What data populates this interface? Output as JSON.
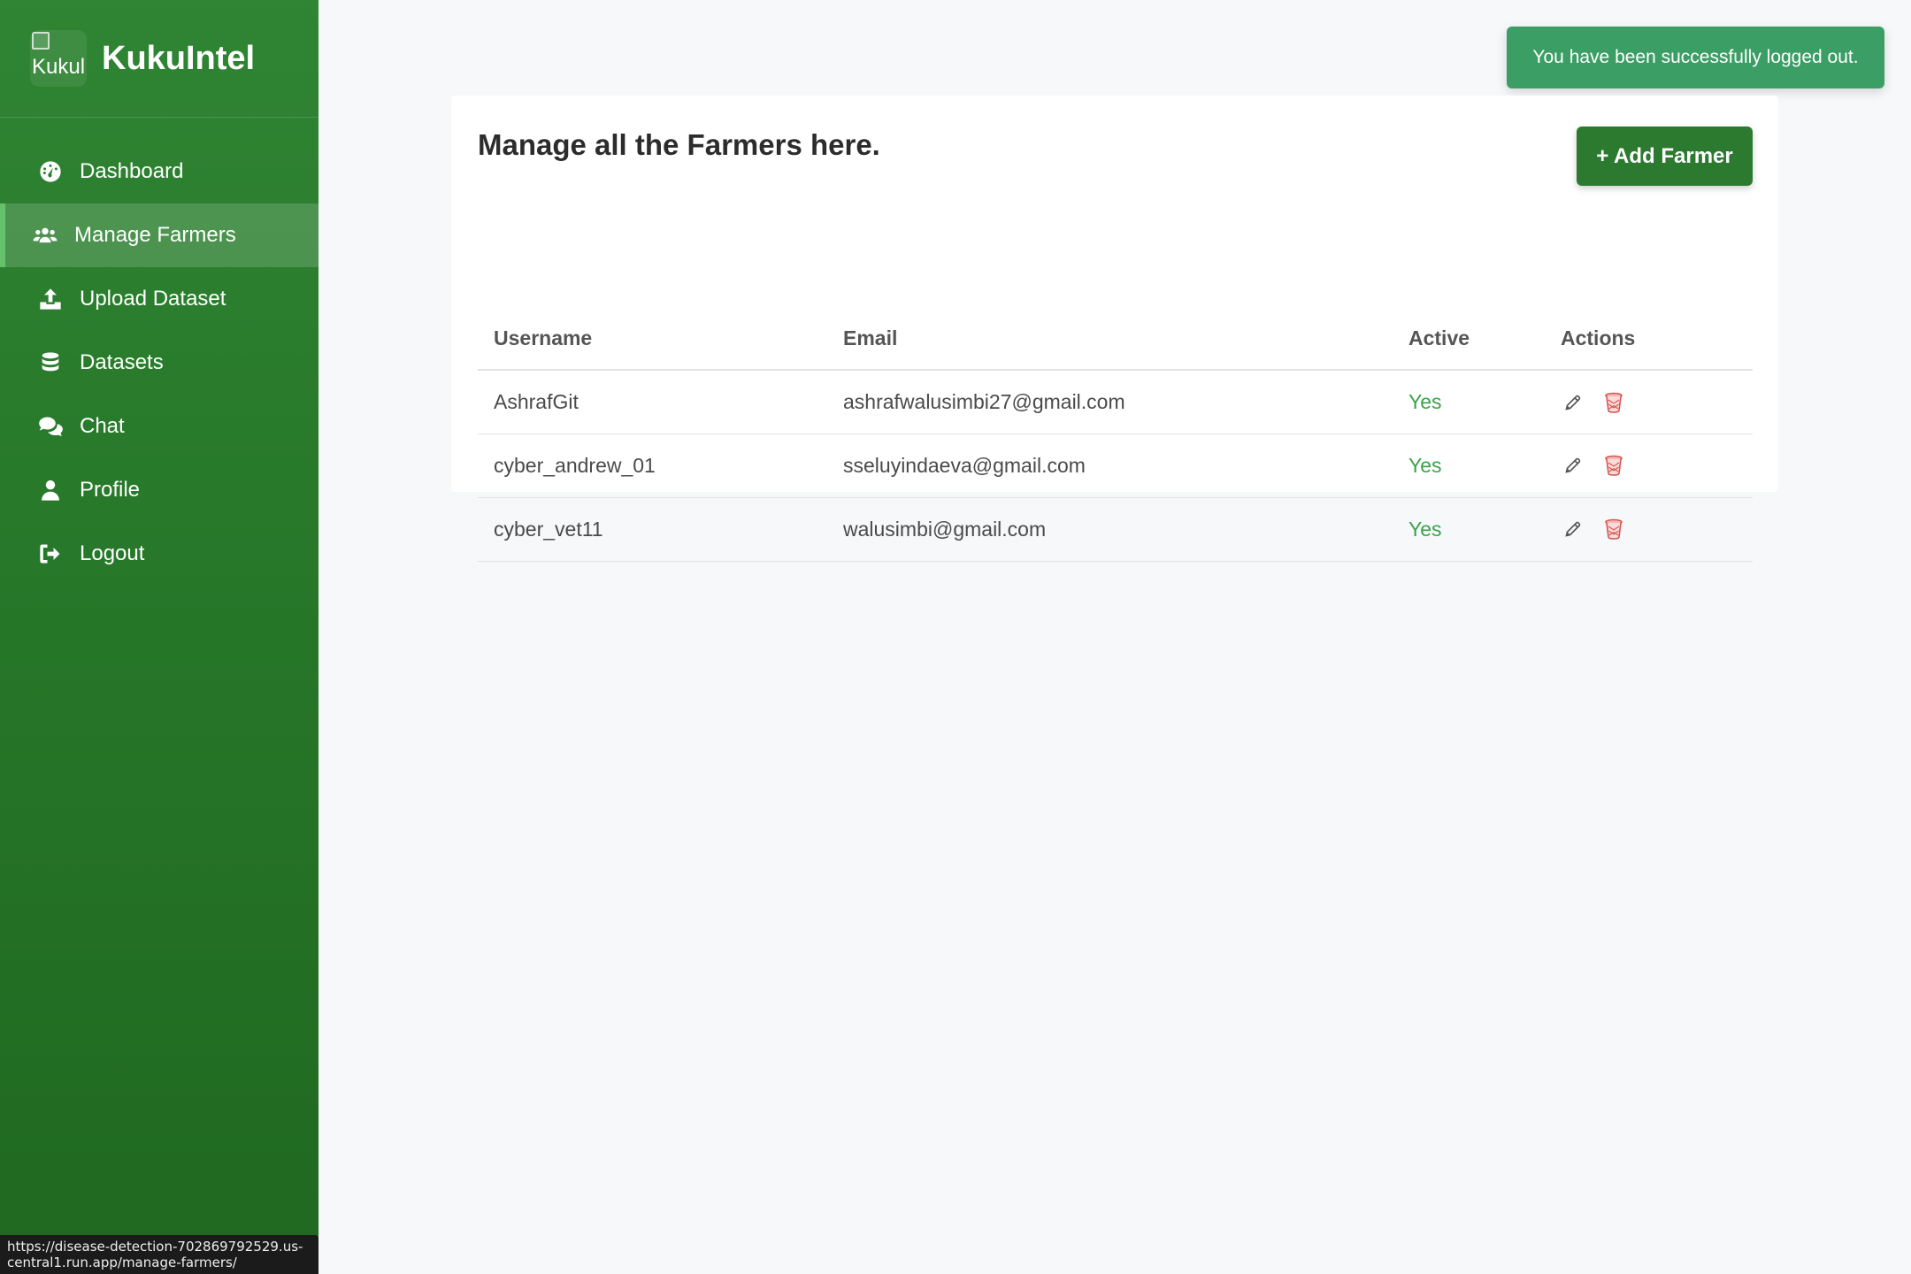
{
  "brand": {
    "logo_alt": "Kukul",
    "name": "KukuIntel"
  },
  "sidebar": {
    "items": [
      {
        "label": "Dashboard",
        "icon": "dashboard-icon"
      },
      {
        "label": "Manage Farmers",
        "icon": "users-icon",
        "active": true
      },
      {
        "label": "Upload Dataset",
        "icon": "upload-icon"
      },
      {
        "label": "Datasets",
        "icon": "database-icon"
      },
      {
        "label": "Chat",
        "icon": "chat-icon"
      },
      {
        "label": "Profile",
        "icon": "user-icon"
      },
      {
        "label": "Logout",
        "icon": "logout-icon"
      }
    ]
  },
  "toast": {
    "message": "You have been successfully logged out."
  },
  "main": {
    "title": "Manage all the Farmers here.",
    "add_button_label": "+ Add Farmer",
    "table": {
      "headers": [
        "Username",
        "Email",
        "Active",
        "Actions"
      ],
      "rows": [
        {
          "username": "AshrafGit",
          "email": "ashrafwalusimbi27@gmail.com",
          "active": "Yes"
        },
        {
          "username": "cyber_andrew_01",
          "email": "sseluyindaeva@gmail.com",
          "active": "Yes"
        },
        {
          "username": "cyber_vet11",
          "email": "walusimbi@gmail.com",
          "active": "Yes"
        }
      ]
    }
  },
  "status_bar": {
    "url": "https://disease-detection-702869792529.us-central1.run.app/manage-farmers/"
  },
  "colors": {
    "sidebar": "#2b7d2f",
    "accent": "#2b7a2f",
    "toast": "#3a9e65",
    "active_text": "#3aa34b",
    "delete_icon": "#d9534f"
  }
}
